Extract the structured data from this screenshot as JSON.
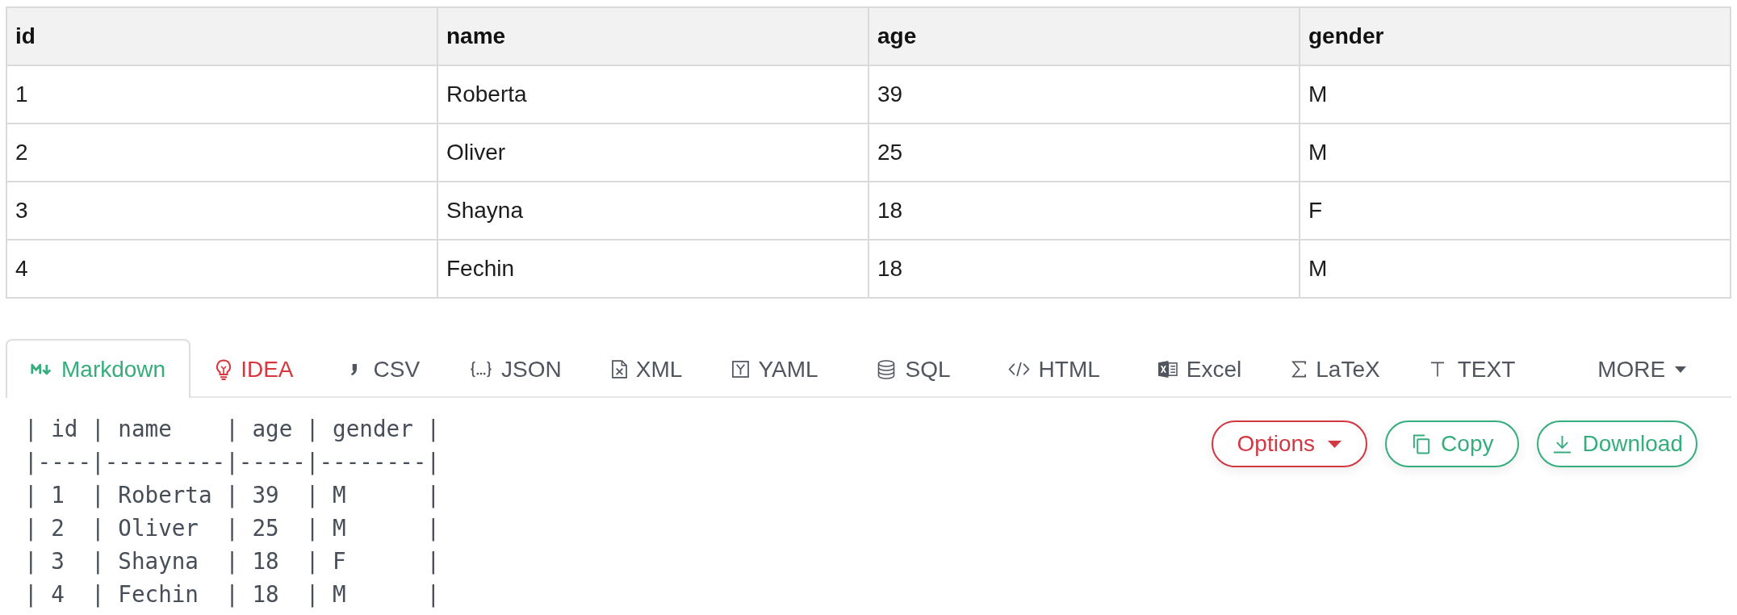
{
  "table": {
    "columns": [
      "id",
      "name",
      "age",
      "gender"
    ],
    "rows": [
      [
        "1",
        "Roberta",
        "39",
        "M"
      ],
      [
        "2",
        "Oliver",
        "25",
        "M"
      ],
      [
        "3",
        "Shayna",
        "18",
        "F"
      ],
      [
        "4",
        "Fechin",
        "18",
        "M"
      ]
    ]
  },
  "format_tabs": [
    {
      "label": "Markdown",
      "kind": "markdown",
      "selected": true
    },
    {
      "label": "IDEA",
      "kind": "idea",
      "selected": false
    },
    {
      "label": "CSV",
      "kind": "csv",
      "selected": false
    },
    {
      "label": "JSON",
      "kind": "json",
      "selected": false
    },
    {
      "label": "XML",
      "kind": "xml",
      "selected": false
    },
    {
      "label": "YAML",
      "kind": "yaml",
      "selected": false
    },
    {
      "label": "SQL",
      "kind": "sql",
      "selected": false
    },
    {
      "label": "HTML",
      "kind": "html",
      "selected": false
    },
    {
      "label": "Excel",
      "kind": "excel",
      "selected": false
    },
    {
      "label": "LaTeX",
      "kind": "latex",
      "selected": false
    },
    {
      "label": "TEXT",
      "kind": "text",
      "selected": false
    }
  ],
  "more_menu": {
    "label": "MORE"
  },
  "output": {
    "lines": [
      "| id | name    | age | gender |",
      "|----|---------|-----|--------|",
      "| 1  | Roberta | 39  | M      |",
      "| 2  | Oliver  | 25  | M      |",
      "| 3  | Shayna  | 18  | F      |",
      "| 4  | Fechin  | 18  | M      |"
    ],
    "buttons": [
      {
        "label": "Options",
        "kind": "options"
      },
      {
        "label": "Copy",
        "kind": "copy"
      },
      {
        "label": "Download",
        "kind": "download"
      }
    ]
  }
}
